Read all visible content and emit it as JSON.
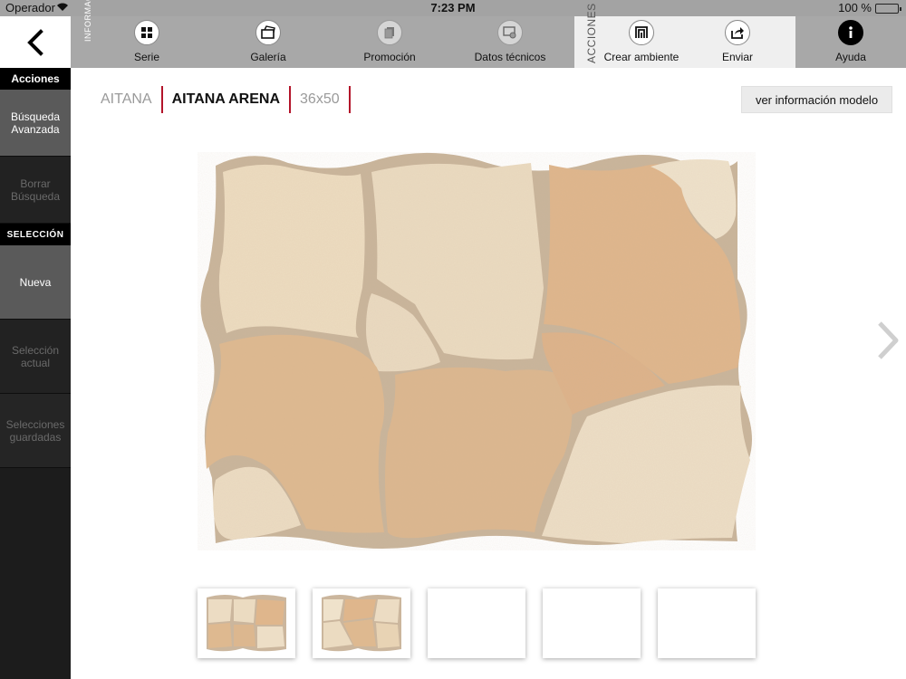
{
  "status_bar": {
    "carrier": "Operador",
    "time": "7:23 PM",
    "battery": "100 %"
  },
  "toolbar": {
    "info_label": "INFORMACIÓN",
    "actions_label": "ACCIONES",
    "info_items": [
      {
        "label": "Serie",
        "icon": "grid-icon"
      },
      {
        "label": "Galería",
        "icon": "gallery-icon"
      },
      {
        "label": "Promoción",
        "icon": "documents-icon"
      },
      {
        "label": "Datos técnicos",
        "icon": "technical-data-icon"
      }
    ],
    "action_items": [
      {
        "label": "Crear ambiente",
        "icon": "room-icon"
      },
      {
        "label": "Enviar",
        "icon": "share-icon"
      }
    ],
    "help_label": "Ayuda"
  },
  "sidebar": {
    "actions_header": "Acciones",
    "advanced_search": "Búsqueda Avanzada",
    "clear_search": "Borrar Búsqueda",
    "selection_header": "SELECCIÓN",
    "new_selection": "Nueva",
    "current_selection": "Selección actual",
    "saved_selections": "Selecciones guardadas"
  },
  "main": {
    "breadcrumb": [
      "AITANA",
      "AITANA ARENA",
      "36x50"
    ],
    "model_info_button": "ver información modelo",
    "thumbnails": [
      {
        "has_image": true
      },
      {
        "has_image": true
      },
      {
        "has_image": false
      },
      {
        "has_image": false
      },
      {
        "has_image": false
      }
    ]
  },
  "colors": {
    "accent": "#b3142a",
    "toolbar_gray": "#a8a8a8",
    "sidebar_bg": "#1c1c1c",
    "tile_grout": "#c7b299",
    "stone_light": "#efe1c8",
    "stone_warm": "#dfb98e"
  }
}
